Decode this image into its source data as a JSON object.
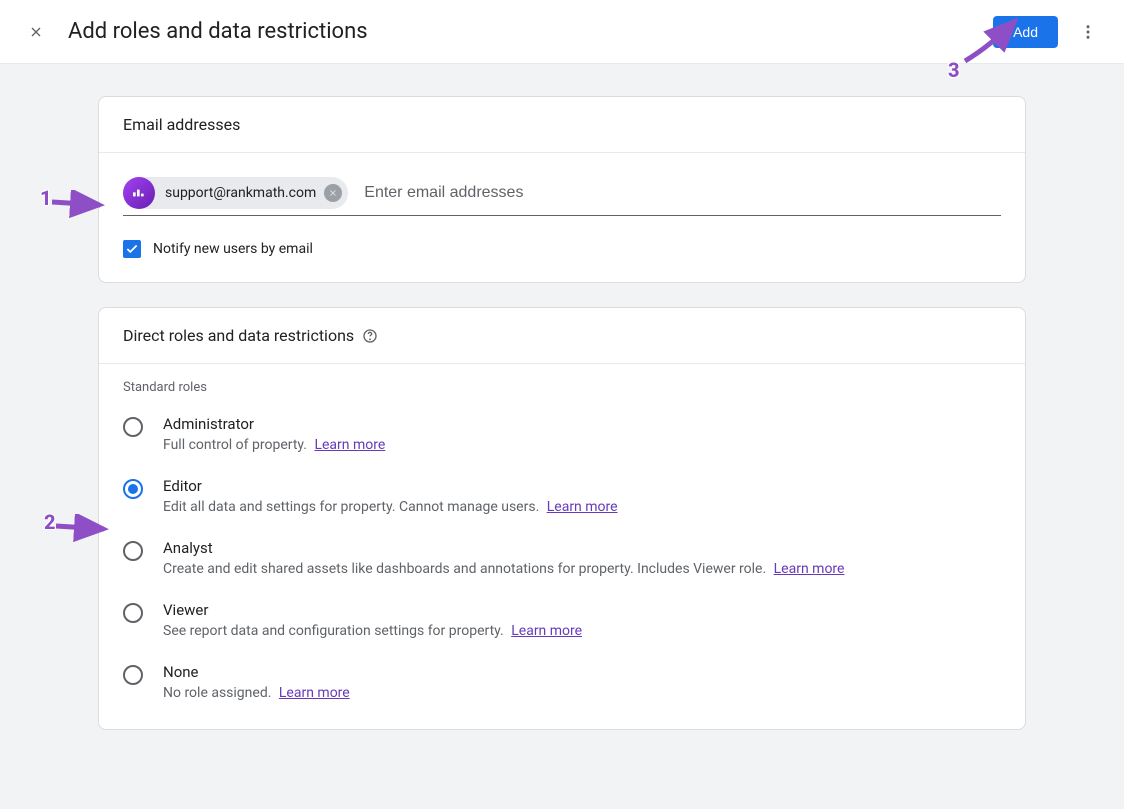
{
  "header": {
    "title": "Add roles and data restrictions",
    "add_button": "Add"
  },
  "email_card": {
    "title": "Email addresses",
    "chip_email": "support@rankmath.com",
    "input_placeholder": "Enter email addresses",
    "notify_label": "Notify new users by email",
    "notify_checked": true
  },
  "roles_card": {
    "title": "Direct roles and data restrictions",
    "standard_roles_label": "Standard roles",
    "learn_more_text": "Learn more",
    "roles": [
      {
        "name": "Administrator",
        "desc": "Full control of property. ",
        "selected": false
      },
      {
        "name": "Editor",
        "desc": "Edit all data and settings for property. Cannot manage users. ",
        "selected": true
      },
      {
        "name": "Analyst",
        "desc": "Create and edit shared assets like dashboards and annotations for property. Includes Viewer role. ",
        "selected": false
      },
      {
        "name": "Viewer",
        "desc": "See report data and configuration settings for property. ",
        "selected": false
      },
      {
        "name": "None",
        "desc": "No role assigned. ",
        "selected": false
      }
    ]
  },
  "annotations": {
    "step1": "1",
    "step2": "2",
    "step3": "3"
  }
}
